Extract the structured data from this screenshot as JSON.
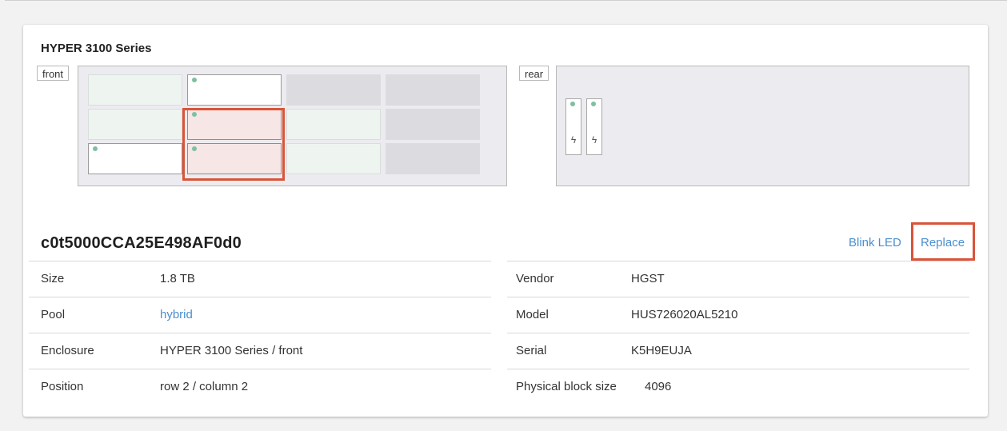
{
  "enclosure": {
    "title": "HYPER 3100 Series",
    "front_label": "front",
    "rear_label": "rear",
    "front_slots": [
      [
        "free",
        "white",
        "empty",
        "empty"
      ],
      [
        "free",
        "selected",
        "free",
        "empty"
      ],
      [
        "white",
        "selected",
        "free",
        "empty"
      ]
    ],
    "rear_psu_count": 2,
    "bolt_glyph": "ϟ"
  },
  "disk": {
    "name": "c0t5000CCA25E498AF0d0",
    "actions": {
      "blink": "Blink LED",
      "replace": "Replace"
    },
    "left_props": [
      {
        "key": "Size",
        "value": "1.8 TB",
        "link": false
      },
      {
        "key": "Pool",
        "value": "hybrid",
        "link": true
      },
      {
        "key": "Enclosure",
        "value": "HYPER 3100 Series / front",
        "link": false
      },
      {
        "key": "Position",
        "value": "row 2 / column 2",
        "link": false
      }
    ],
    "right_props": [
      {
        "key": "Vendor",
        "value": "HGST"
      },
      {
        "key": "Model",
        "value": "HUS726020AL5210"
      },
      {
        "key": "Serial",
        "value": "K5H9EUJA"
      },
      {
        "key": "Physical block size",
        "value": "4096"
      }
    ]
  },
  "colors": {
    "accent": "#4b8fd1",
    "highlight": "#d9543a",
    "status_dot": "#7fbfa0"
  }
}
